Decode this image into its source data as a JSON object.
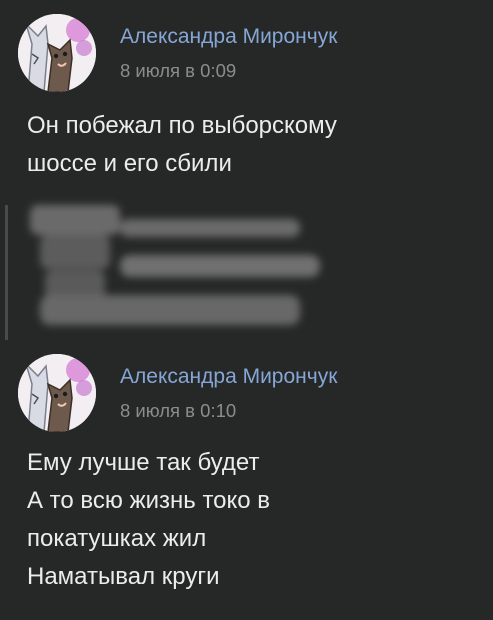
{
  "posts": [
    {
      "author": "Александра Мирончук",
      "date": "8 июля в 0:09",
      "text_lines": [
        "Он побежал по выборскому",
        "шоссе и его сбили"
      ],
      "avatar_icon": "cat-character-avatar"
    },
    {
      "author": "Александра Мирончук",
      "date": "8 июля в 0:10",
      "text_lines": [
        "Ему лучше так будет",
        "А то всю жизнь токо в",
        "покатушках жил",
        "Наматывал круги"
      ],
      "avatar_icon": "cat-character-avatar"
    }
  ],
  "colors": {
    "background": "#262727",
    "author_link": "#86a7d6",
    "date": "#8c8c8c",
    "text": "#ececec",
    "redaction": "#5f5f5f"
  }
}
